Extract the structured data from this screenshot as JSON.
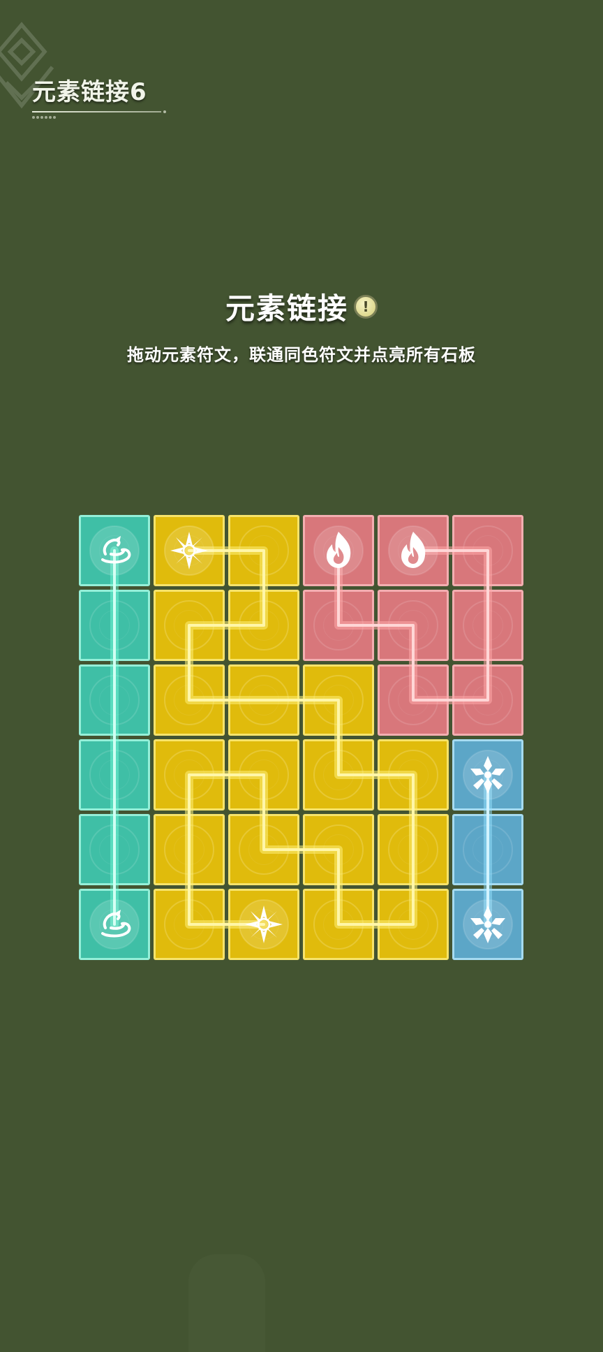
{
  "level": {
    "title": "元素链接6"
  },
  "puzzle": {
    "heading": "元素链接",
    "hint_icon": "exclamation-icon",
    "instructions": "拖动元素符文，联通同色符文并点亮所有石板"
  },
  "colors": {
    "background": "#435431",
    "anemo": "#3fbfa6",
    "geo": "#e0bb0c",
    "pyro": "#d8777b",
    "cryo": "#5ca6c7"
  },
  "board": {
    "rows": 6,
    "cols": 6,
    "cells": [
      [
        "anemo",
        "geo",
        "geo",
        "pyro",
        "pyro",
        "pyro"
      ],
      [
        "anemo",
        "geo",
        "geo",
        "pyro",
        "pyro",
        "pyro"
      ],
      [
        "anemo",
        "geo",
        "geo",
        "geo",
        "pyro",
        "pyro"
      ],
      [
        "anemo",
        "geo",
        "geo",
        "geo",
        "geo",
        "cryo"
      ],
      [
        "anemo",
        "geo",
        "geo",
        "geo",
        "geo",
        "cryo"
      ],
      [
        "anemo",
        "geo",
        "geo",
        "geo",
        "geo",
        "cryo"
      ]
    ],
    "runes": [
      {
        "element": "anemo",
        "icon": "anemo-icon",
        "row": 0,
        "col": 0
      },
      {
        "element": "anemo",
        "icon": "anemo-icon",
        "row": 5,
        "col": 0
      },
      {
        "element": "geo",
        "icon": "geo-icon",
        "row": 0,
        "col": 1
      },
      {
        "element": "geo",
        "icon": "geo-icon",
        "row": 5,
        "col": 2
      },
      {
        "element": "pyro",
        "icon": "pyro-icon",
        "row": 0,
        "col": 3
      },
      {
        "element": "pyro",
        "icon": "pyro-icon",
        "row": 0,
        "col": 4
      },
      {
        "element": "cryo",
        "icon": "cryo-icon",
        "row": 3,
        "col": 5
      },
      {
        "element": "cryo",
        "icon": "cryo-icon",
        "row": 5,
        "col": 5
      }
    ],
    "paths": [
      {
        "element": "anemo",
        "cells": [
          [
            0,
            0
          ],
          [
            1,
            0
          ],
          [
            2,
            0
          ],
          [
            3,
            0
          ],
          [
            4,
            0
          ],
          [
            5,
            0
          ]
        ]
      },
      {
        "element": "geo",
        "cells": [
          [
            0,
            1
          ],
          [
            0,
            2
          ],
          [
            1,
            2
          ],
          [
            1,
            1
          ],
          [
            2,
            1
          ],
          [
            2,
            2
          ],
          [
            2,
            3
          ],
          [
            3,
            3
          ],
          [
            3,
            4
          ],
          [
            4,
            4
          ],
          [
            5,
            4
          ],
          [
            5,
            3
          ],
          [
            4,
            3
          ],
          [
            4,
            2
          ],
          [
            3,
            2
          ],
          [
            3,
            1
          ],
          [
            4,
            1
          ],
          [
            5,
            1
          ],
          [
            5,
            2
          ]
        ]
      },
      {
        "element": "pyro",
        "cells": [
          [
            0,
            3
          ],
          [
            1,
            3
          ],
          [
            1,
            4
          ],
          [
            2,
            4
          ],
          [
            2,
            5
          ],
          [
            1,
            5
          ],
          [
            0,
            5
          ],
          [
            0,
            4
          ]
        ]
      },
      {
        "element": "cryo",
        "cells": [
          [
            3,
            5
          ],
          [
            4,
            5
          ],
          [
            5,
            5
          ]
        ]
      }
    ]
  }
}
